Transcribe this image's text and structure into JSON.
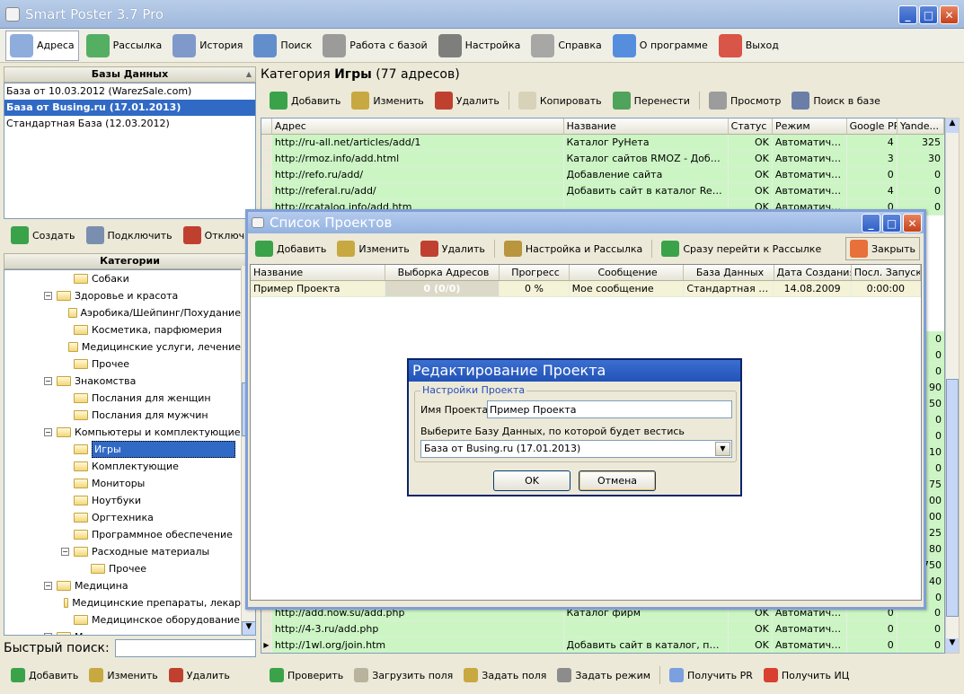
{
  "app": {
    "title": "Smart Poster 3.7 Pro"
  },
  "main_toolbar": [
    {
      "label": "Адреса",
      "icon": "addresses-icon",
      "color": "#7a9ed6"
    },
    {
      "label": "Рассылка",
      "icon": "mailing-icon",
      "color": "#3aa34a"
    },
    {
      "label": "История",
      "icon": "history-icon",
      "color": "#6b8ac4"
    },
    {
      "label": "Поиск",
      "icon": "search-globe-icon",
      "color": "#4a7cc7"
    },
    {
      "label": "Работа с базой",
      "icon": "database-icon",
      "color": "#8c8c8c"
    },
    {
      "label": "Настройка",
      "icon": "wrench-icon",
      "color": "#6a6a6a"
    },
    {
      "label": "Справка",
      "icon": "help-icon",
      "color": "#9a9a9a"
    },
    {
      "label": "О программе",
      "icon": "info-icon",
      "color": "#3b7ddc"
    },
    {
      "label": "Выход",
      "icon": "exit-icon",
      "color": "#d43a2a"
    }
  ],
  "databases": {
    "header": "Базы Данных",
    "items": [
      {
        "label": "База от 10.03.2012 (WarezSale.com)",
        "selected": false
      },
      {
        "label": "База от Busing.ru (17.01.2013)",
        "selected": true
      },
      {
        "label": "Стандартная База (12.03.2012)",
        "selected": false
      }
    ],
    "toolbar": [
      "Создать",
      "Подключить",
      "Отключит"
    ]
  },
  "categories": {
    "header": "Категории",
    "items": [
      {
        "label": "Собаки",
        "level": 2,
        "sign": ""
      },
      {
        "label": "Здоровье и красота",
        "level": 1,
        "sign": "−"
      },
      {
        "label": "Аэробика/Шейпинг/Похудание",
        "level": 2,
        "sign": ""
      },
      {
        "label": "Косметика, парфюмерия",
        "level": 2,
        "sign": ""
      },
      {
        "label": "Медицинские услуги, лечение",
        "level": 2,
        "sign": ""
      },
      {
        "label": "Прочее",
        "level": 2,
        "sign": ""
      },
      {
        "label": "Знакомства",
        "level": 1,
        "sign": "−"
      },
      {
        "label": "Послания для женщин",
        "level": 2,
        "sign": ""
      },
      {
        "label": "Послания для мужчин",
        "level": 2,
        "sign": ""
      },
      {
        "label": "Компьютеры и комплектующие",
        "level": 1,
        "sign": "−"
      },
      {
        "label": "Игры",
        "level": 2,
        "sign": "",
        "selected": true
      },
      {
        "label": "Комплектующие",
        "level": 2,
        "sign": ""
      },
      {
        "label": "Мониторы",
        "level": 2,
        "sign": ""
      },
      {
        "label": "Ноутбуки",
        "level": 2,
        "sign": ""
      },
      {
        "label": "Оргтехника",
        "level": 2,
        "sign": ""
      },
      {
        "label": "Программное обеспечение",
        "level": 2,
        "sign": ""
      },
      {
        "label": "Расходные материалы",
        "level": 2,
        "sign": "−"
      },
      {
        "label": "Прочее",
        "level": 3,
        "sign": ""
      },
      {
        "label": "Медицина",
        "level": 1,
        "sign": "−"
      },
      {
        "label": "Медицинские препараты, лекар",
        "level": 2,
        "sign": ""
      },
      {
        "label": "Медицинское оборудование",
        "level": 2,
        "sign": ""
      },
      {
        "label": "Металлургия",
        "level": 1,
        "sign": "+"
      }
    ]
  },
  "quick_search": {
    "label": "Быстрый поиск:",
    "value": ""
  },
  "left_bottom_toolbar": [
    "Добавить",
    "Изменить",
    "Удалить"
  ],
  "category_header": {
    "prefix": "Категория",
    "name": "Игры",
    "count": "(77 адресов)"
  },
  "addr_toolbar": [
    "Добавить",
    "Изменить",
    "Удалить",
    "Копировать",
    "Перенести",
    "Просмотр",
    "Поиск в базе"
  ],
  "addr_grid": {
    "columns": [
      "Адрес",
      "Название",
      "Статус",
      "Режим",
      "Google PR",
      "Yande..."
    ],
    "rows_top": [
      [
        "http://ru-all.net/articles/add/1",
        "Каталог РуНета",
        "OK",
        "Автоматичес...",
        "4",
        "325"
      ],
      [
        "http://rmoz.info/add.html",
        "Каталог сайтов RMOZ - Добавит...",
        "OK",
        "Автоматичес...",
        "3",
        "30"
      ],
      [
        "http://refo.ru/add/",
        "Добавление сайта",
        "OK",
        "Автоматичес...",
        "0",
        "0"
      ],
      [
        "http://referal.ru/add/",
        "Добавить сайт в каталог Referal...",
        "OK",
        "Автоматичес...",
        "4",
        "0"
      ],
      [
        "http://rcatalog.info/add.htm",
        "",
        "OK",
        "Автоматичес...",
        "0",
        "0"
      ]
    ],
    "right_values": [
      "0",
      "0",
      "0",
      "90",
      "50",
      "0",
      "0",
      "10",
      "0",
      "75",
      "00",
      "00",
      "25",
      "80",
      "750",
      "40",
      "0",
      "0",
      "10",
      "0",
      "0",
      "10"
    ],
    "rows_bottom": [
      [
        "http://add.now.su/add.php",
        "Каталог фирм",
        "OK",
        "Автоматичес...",
        "0",
        "0"
      ],
      [
        "http://4-3.ru/add.php",
        "",
        "OK",
        "Автоматичес...",
        "0",
        "0"
      ],
      [
        "http://1wl.org/join.htm",
        "Добавить сайт в каталог, поиск...",
        "OK",
        "Автоматичес...",
        "0",
        "0"
      ]
    ]
  },
  "bottom_toolbar": [
    "Проверить",
    "Загрузить поля",
    "Задать поля",
    "Задать режим",
    "Получить PR",
    "Получить ИЦ"
  ],
  "projects_window": {
    "title": "Список Проектов",
    "toolbar": [
      "Добавить",
      "Изменить",
      "Удалить",
      "Настройка и Рассылка",
      "Сразу перейти к Рассылке"
    ],
    "close_label": "Закрыть",
    "columns": [
      "Название",
      "Выборка Адресов",
      "Прогресс",
      "Сообщение",
      "База Данных",
      "Дата Создания",
      "Посл. Запуск"
    ],
    "rows": [
      [
        "Пример Проекта",
        "0 (0/0)",
        "0 %",
        "Мое сообщение",
        "Стандартная Ба...",
        "14.08.2009",
        "0:00:00"
      ]
    ]
  },
  "edit_dialog": {
    "title": "Редактирование Проекта",
    "group": "Настройки Проекта",
    "name_label": "Имя Проекта:",
    "name_value": "Пример Проекта",
    "db_label": "Выберите Базу Данных, по которой будет вестись рассылка:",
    "db_value": "База от Busing.ru (17.01.2013)",
    "ok": "OK",
    "cancel": "Отмена"
  }
}
